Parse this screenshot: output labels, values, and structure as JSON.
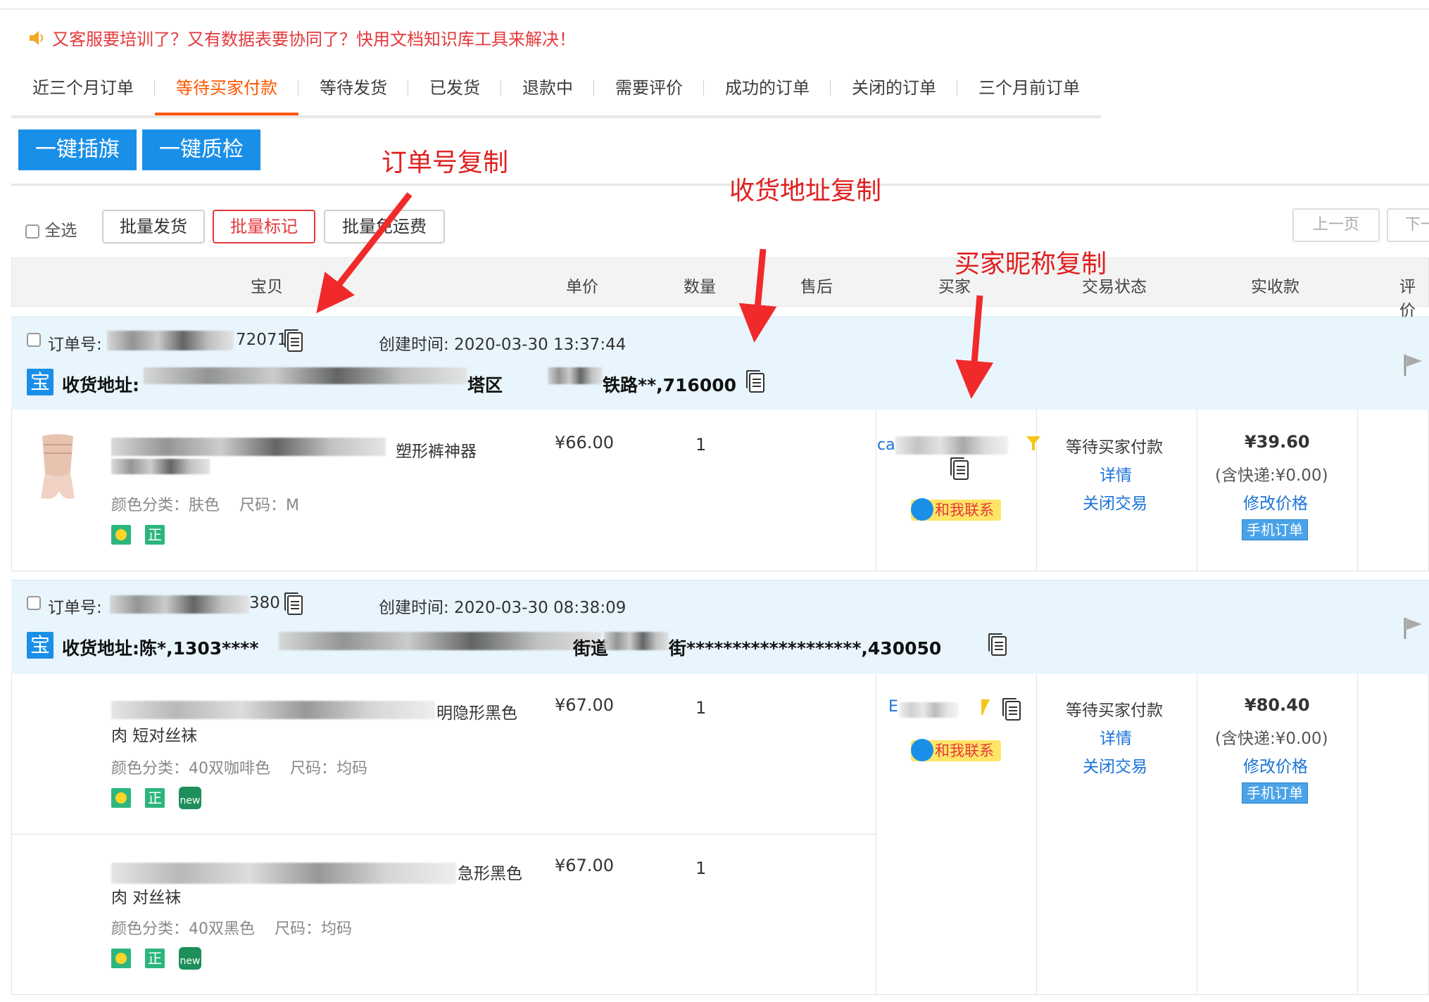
{
  "notice": {
    "text": "又客服要培训了？又有数据表要协同了？快用文档知识库工具来解决！"
  },
  "tabs": [
    {
      "label": "近三个月订单"
    },
    {
      "label": "等待买家付款"
    },
    {
      "label": "等待发货"
    },
    {
      "label": "已发货"
    },
    {
      "label": "退款中"
    },
    {
      "label": "需要评价"
    },
    {
      "label": "成功的订单"
    },
    {
      "label": "关闭的订单"
    },
    {
      "label": "三个月前订单"
    }
  ],
  "actions": {
    "insert_flag": "一键插旗",
    "quality_check": "一键质检"
  },
  "batch": {
    "select_all": "全选",
    "ship": "批量发货",
    "mark": "批量标记",
    "free_shipping": "批量免运费",
    "prev": "上一页",
    "next": "下一页"
  },
  "columns": {
    "item": "宝贝",
    "unit_price": "单价",
    "qty": "数量",
    "after_sale": "售后",
    "buyer": "买家",
    "status": "交易状态",
    "received": "实收款",
    "review": "评价"
  },
  "annotations": {
    "order_no": "订单号复制",
    "address": "收货地址复制",
    "buyer_nick": "买家昵称复制"
  },
  "orders": [
    {
      "order_label": "订单号:",
      "order_no_tail": "72071",
      "created": "创建时间: 2020-03-30 13:37:44",
      "addr_prefix": "收货地址:",
      "addr_mid1": "塔区",
      "addr_mid2": "铁路**,716000",
      "items": [
        {
          "title_tail": "塑形裤神器",
          "sku": "颜色分类：肤色    尺码：M",
          "price": "¥66.00",
          "qty": "1"
        }
      ],
      "buyer_prefix": "ca",
      "contact": "和我联系",
      "status": "等待买家付款",
      "detail": "详情",
      "close": "关闭交易",
      "total": "¥39.60",
      "shipping": "(含快递:¥0.00)",
      "modify": "修改价格",
      "mobile": "手机订单"
    },
    {
      "order_label": "订单号:",
      "order_no_tail": "380",
      "created": "创建时间: 2020-03-30 08:38:09",
      "addr_prefix": "收货地址:陈*,1303****",
      "addr_mid1": "街道",
      "addr_mid2": "街*******************,430050",
      "items": [
        {
          "title_tail": "明隐形黑色",
          "title2": "肉 短对丝袜",
          "sku": "颜色分类：40双咖啡色    尺码：均码",
          "price": "¥67.00",
          "qty": "1"
        },
        {
          "title_tail": "急形黑色",
          "title2": "肉 对丝袜",
          "sku": "颜色分类：40双黑色    尺码：均码",
          "price": "¥67.00",
          "qty": "1"
        }
      ],
      "buyer_prefix": "E",
      "contact": "和我联系",
      "status": "等待买家付款",
      "detail": "详情",
      "close": "关闭交易",
      "total": "¥80.40",
      "shipping": "(含快递:¥0.00)",
      "modify": "修改价格",
      "mobile": "手机订单"
    }
  ],
  "tags": {
    "zheng": "正",
    "new": "new"
  },
  "colors": {
    "accent": "#ff5500",
    "primary_blue": "#1a8fe8",
    "annotation_red": "#e02020",
    "order_header_bg": "#e8f5fd"
  }
}
